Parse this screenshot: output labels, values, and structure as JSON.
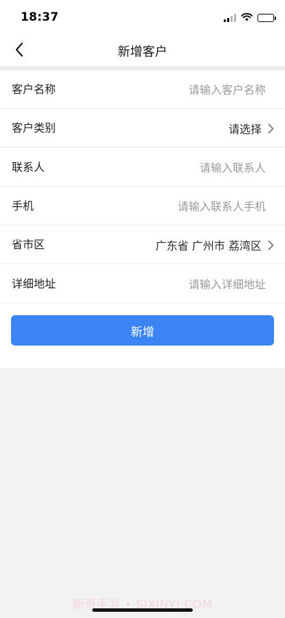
{
  "status_bar": {
    "time": "18:37",
    "icons": [
      "signal-icon",
      "wifi-icon",
      "battery-icon"
    ]
  },
  "nav": {
    "back_icon": "chevron-left-icon",
    "title": "新增客户"
  },
  "form": {
    "customer_name": {
      "label": "客户名称",
      "placeholder": "请输入客户名称",
      "value": ""
    },
    "customer_type": {
      "label": "客户类别",
      "value": "请选择",
      "icon": "chevron-right-icon"
    },
    "contact": {
      "label": "联系人",
      "placeholder": "请输入联系人",
      "value": ""
    },
    "mobile": {
      "label": "手机",
      "placeholder": "请输入联系人手机",
      "value": ""
    },
    "region": {
      "label": "省市区",
      "value": "广东省 广州市 荔湾区",
      "icon": "chevron-right-icon"
    },
    "address": {
      "label": "详细地址",
      "placeholder": "请输入详细地址",
      "value": ""
    }
  },
  "submit_label": "新增",
  "watermark": "新奇手游 • SIXINYI.COM",
  "colors": {
    "accent": "#3c84f4",
    "background": "#f2f2f2",
    "surface": "#ffffff",
    "placeholder": "#9a9a9a"
  }
}
